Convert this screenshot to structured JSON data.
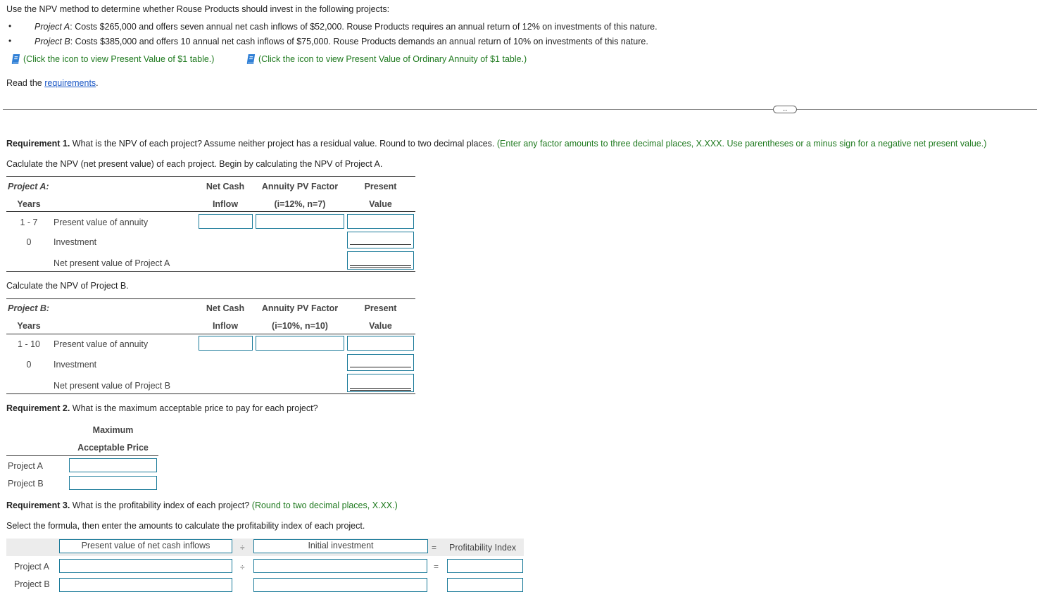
{
  "intro": {
    "prompt": "Use the NPV method to determine whether Rouse Products should invest in the following projects:",
    "bullets": [
      {
        "label": "Project A",
        "text": ": Costs $265,000 and offers seven annual net cash inflows of $52,000. Rouse Products requires an annual return of 12% on investments of this nature."
      },
      {
        "label": "Project B",
        "text": ": Costs $385,000 and offers 10 annual net cash inflows of $75,000. Rouse Products demands an annual return of 10% on investments of this nature."
      }
    ],
    "table_links": [
      {
        "icon": "book-icon",
        "text": "(Click the icon to view Present Value of $1 table.)"
      },
      {
        "icon": "book-icon",
        "text": "(Click the icon to view Present Value of Ordinary Annuity of $1 table.)"
      }
    ],
    "read_prefix": "Read the ",
    "read_link": "requirements",
    "read_suffix": ".",
    "more_button": "..."
  },
  "req1": {
    "title_bold": "Requirement 1.",
    "title_text": " What is the NPV of each project? Assume neither project has a residual value. Round to two decimal places.",
    "instruction": " (Enter any factor amounts to three decimal places, X.XXX. Use parentheses or a minus sign for a negative net present value.)",
    "intro_a": "Caclulate the NPV (net present value) of each project. Begin by calculating the NPV of Project A.",
    "intro_b": "Calculate the NPV of Project B.",
    "project_a": {
      "label": "Project A:",
      "years_header": "Years",
      "col1": [
        "Net Cash",
        "Inflow"
      ],
      "col2": [
        "Annuity PV Factor",
        "(i=12%, n=7)"
      ],
      "col3": [
        "Present",
        "Value"
      ],
      "rows": [
        {
          "years": "1 - 7",
          "desc": "Present value of annuity"
        },
        {
          "years": "0",
          "desc": "Investment"
        },
        {
          "years": "",
          "desc": "Net present value of Project A"
        }
      ],
      "inputs": {
        "net_cash_inflow": "",
        "annuity_factor": "",
        "pv_annuity": "",
        "investment": "",
        "npv": ""
      }
    },
    "project_b": {
      "label": "Project B:",
      "years_header": "Years",
      "col1": [
        "Net Cash",
        "Inflow"
      ],
      "col2": [
        "Annuity PV Factor",
        "(i=10%, n=10)"
      ],
      "col3": [
        "Present",
        "Value"
      ],
      "rows": [
        {
          "years": "1 - 10",
          "desc": "Present value of annuity"
        },
        {
          "years": "0",
          "desc": "Investment"
        },
        {
          "years": "",
          "desc": "Net present value of Project B"
        }
      ],
      "inputs": {
        "net_cash_inflow": "",
        "annuity_factor": "",
        "pv_annuity": "",
        "investment": "",
        "npv": ""
      }
    }
  },
  "req2": {
    "title_bold": "Requirement 2.",
    "title_text": " What is the maximum acceptable price to pay for each project?",
    "header": [
      "Maximum",
      "Acceptable Price"
    ],
    "rows": [
      {
        "label": "Project A",
        "value": ""
      },
      {
        "label": "Project B",
        "value": ""
      }
    ]
  },
  "req3": {
    "title_bold": "Requirement 3.",
    "title_text": " What is the profitability index of each project?",
    "instruction": " (Round to two decimal places, X.XX.)",
    "intro": "Select the formula, then enter the amounts to calculate the profitability index of each project.",
    "formula": {
      "numerator": "Present value of net cash inflows",
      "divide": "÷",
      "denominator": "Initial investment",
      "equals": "=",
      "result": "Profitability Index"
    },
    "rows": [
      {
        "label": "Project A",
        "numerator": "",
        "denominator": "",
        "result": ""
      },
      {
        "label": "Project B",
        "numerator": "",
        "denominator": "",
        "result": ""
      }
    ]
  }
}
